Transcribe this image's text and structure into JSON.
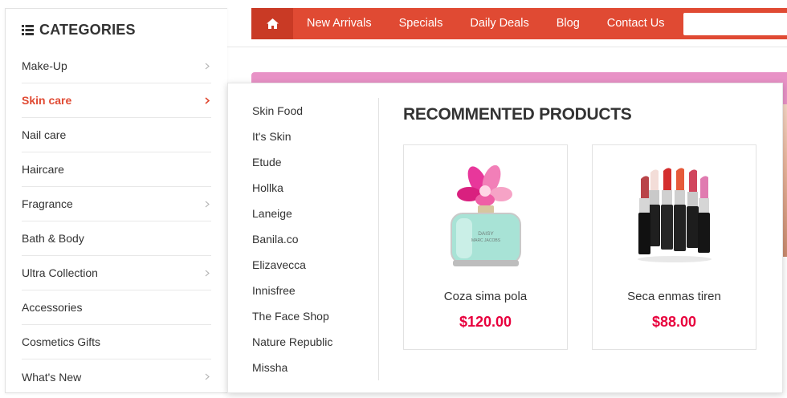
{
  "nav": {
    "home_icon": "home-icon",
    "links": [
      "New Arrivals",
      "Specials",
      "Daily Deals",
      "Blog",
      "Contact Us"
    ],
    "search_value": "",
    "accent_color": "#e04a33"
  },
  "sidebar": {
    "title": "CATEGORIES",
    "title_icon": "list-icon",
    "items": [
      {
        "label": "Make-Up",
        "has_sub": true,
        "active": false
      },
      {
        "label": "Skin care",
        "has_sub": true,
        "active": true
      },
      {
        "label": "Nail care",
        "has_sub": false,
        "active": false
      },
      {
        "label": "Haircare",
        "has_sub": false,
        "active": false
      },
      {
        "label": "Fragrance",
        "has_sub": true,
        "active": false
      },
      {
        "label": "Bath & Body",
        "has_sub": false,
        "active": false
      },
      {
        "label": "Ultra Collection",
        "has_sub": true,
        "active": false
      },
      {
        "label": "Accessories",
        "has_sub": false,
        "active": false
      },
      {
        "label": "Cosmetics Gifts",
        "has_sub": false,
        "active": false
      },
      {
        "label": "What's New",
        "has_sub": true,
        "active": false
      }
    ]
  },
  "mega_menu": {
    "subcategories": [
      "Skin Food",
      "It's Skin",
      "Etude",
      "Hollka",
      "Laneige",
      "Banila.co",
      "Elizavecca",
      "Innisfree",
      "The Face Shop",
      "Nature Republic",
      "Missha"
    ],
    "recommended_title": "RECOMMENTED PRODUCTS",
    "products": [
      {
        "name": "Coza sima pola",
        "price": "$120.00",
        "image": "perfume-bottle-image",
        "bottle_text": "DAISY",
        "bottle_subtext": "MARC JACOBS"
      },
      {
        "name": "Seca enmas tiren",
        "price": "$88.00",
        "image": "lipsticks-image"
      }
    ],
    "price_color": "#e8003d"
  }
}
